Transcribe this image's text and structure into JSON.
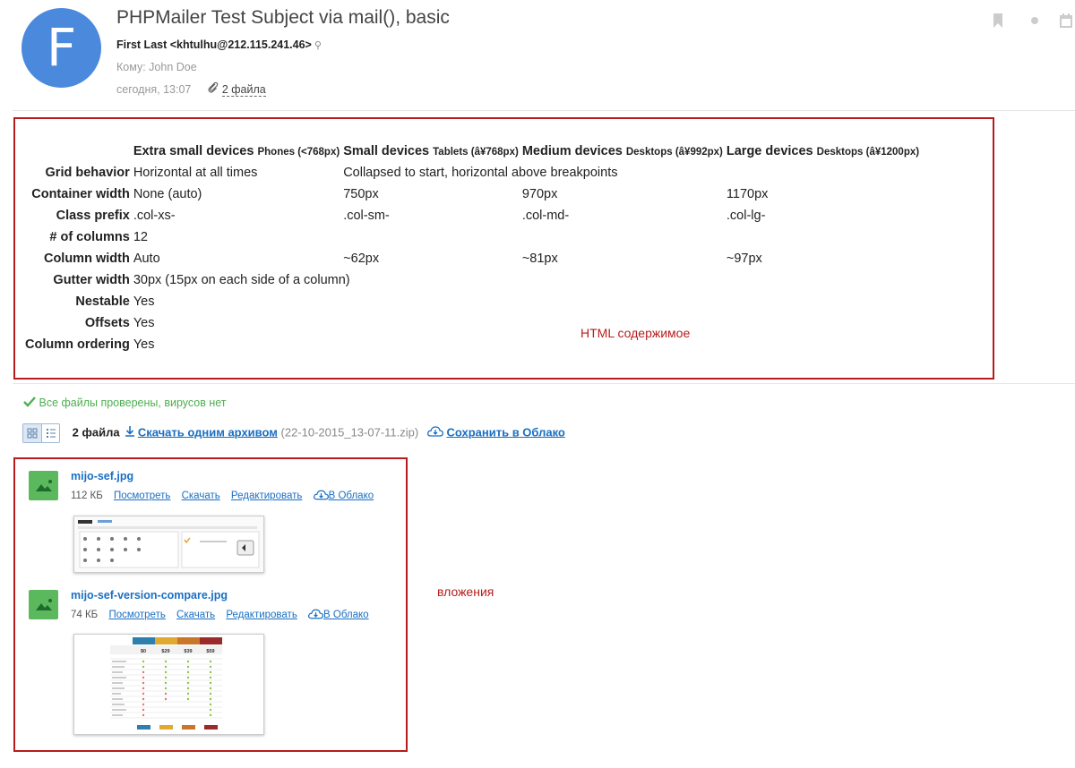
{
  "avatar": {
    "letter": "F",
    "color": "#4a89dc"
  },
  "message": {
    "subject": "PHPMailer Test Subject via mail(), basic",
    "from": "First Last <khtulhu@212.115.241.46>",
    "to": "Кому: John Doe",
    "date": "сегодня, 13:07",
    "attachments_count": "2 файла"
  },
  "grid_table": {
    "headers": [
      {
        "main": "Extra small devices",
        "sub": "Phones (<768px)"
      },
      {
        "main": "Small devices",
        "sub": "Tablets (â¥768px)"
      },
      {
        "main": "Medium devices",
        "sub": "Desktops (â¥992px)"
      },
      {
        "main": "Large devices",
        "sub": "Desktops (â¥1200px)"
      }
    ],
    "rows": [
      {
        "label": "Grid behavior",
        "cells": [
          "Horizontal at all times",
          "Collapsed to start, horizontal above breakpoints"
        ]
      },
      {
        "label": "Container width",
        "cells": [
          "None (auto)",
          "750px",
          "970px",
          "1170px"
        ]
      },
      {
        "label": "Class prefix",
        "cells": [
          ".col-xs-",
          ".col-sm-",
          ".col-md-",
          ".col-lg-"
        ]
      },
      {
        "label": "# of columns",
        "cells": [
          "12"
        ]
      },
      {
        "label": "Column width",
        "cells": [
          "Auto",
          "~62px",
          "~81px",
          "~97px"
        ]
      },
      {
        "label": "Gutter width",
        "cells": [
          "30px (15px on each side of a column)"
        ]
      },
      {
        "label": "Nestable",
        "cells": [
          "Yes"
        ]
      },
      {
        "label": "Offsets",
        "cells": [
          "Yes"
        ]
      },
      {
        "label": "Column ordering",
        "cells": [
          "Yes"
        ]
      }
    ]
  },
  "annotations": {
    "html_content": "HTML содержимое",
    "attachments": "вложения"
  },
  "virus_check": "Все файлы проверены, вирусов нет",
  "attachment_bar": {
    "count": "2 файла",
    "download_all": "Скачать одним архивом",
    "archive_name": "(22-10-2015_13-07-11.zip)",
    "save_cloud": "Сохранить в Облако"
  },
  "files": [
    {
      "name": "mijo-sef.jpg",
      "size": "112 КБ",
      "view": "Посмотреть",
      "download": "Скачать",
      "edit": "Редактировать",
      "cloud": "В Облако"
    },
    {
      "name": "mijo-sef-version-compare.jpg",
      "size": "74 КБ",
      "view": "Посмотреть",
      "download": "Скачать",
      "edit": "Редактировать",
      "cloud": "В Облако"
    }
  ],
  "thumb2": {
    "prices": [
      "$0",
      "$29",
      "$39",
      "$59"
    ]
  },
  "colors": {
    "accent": "#1a6fc2",
    "annotation_border": "#b71c1c",
    "success": "#4caf50",
    "file_icon": "#5cb85c"
  }
}
